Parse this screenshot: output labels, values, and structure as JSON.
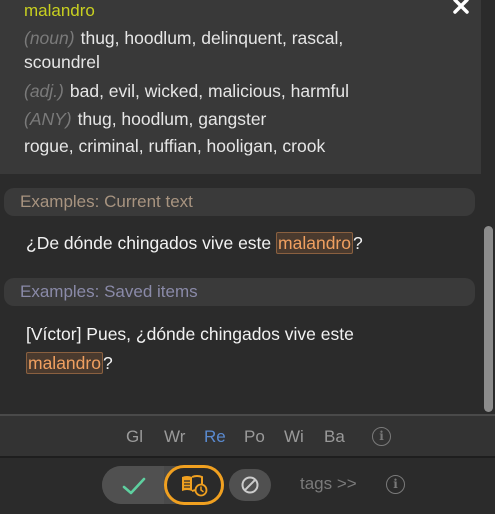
{
  "entry": {
    "headword": "malandro",
    "definitions": [
      {
        "pos": "(noun)",
        "text": "thug, hoodlum, delinquent, rascal,"
      },
      {
        "pos": "",
        "text": "scoundrel"
      },
      {
        "pos": "(adj.)",
        "text": "bad, evil, wicked, malicious, harmful"
      },
      {
        "pos": "(ANY)",
        "text": "thug, hoodlum, gangster"
      },
      {
        "pos": "",
        "text": "rogue, criminal, ruffian, hooligan, crook"
      }
    ]
  },
  "examples": {
    "current_header": "Examples: Current text",
    "current": {
      "before": "¿De dónde chingados vive este ",
      "highlight": "malandro",
      "after": "?"
    },
    "saved_header": "Examples: Saved items",
    "saved": {
      "line1": "[Víctor] Pues, ¿dónde chingados vive este",
      "highlight": "malandro",
      "after": "?"
    }
  },
  "dictionaries": [
    "Gl",
    "Wr",
    "Re",
    "Po",
    "Wi",
    "Ba"
  ],
  "active_dictionary": "Re",
  "actions": {
    "tags_label": "tags >>"
  },
  "icons": {
    "close": "close-icon",
    "info": "info-icon",
    "check": "check-icon",
    "bookmark": "book-clock-icon",
    "ignore": "prohibit-icon"
  },
  "colors": {
    "headword": "#c8d020",
    "highlight": "#f0a060",
    "active_dict": "#5a8ad0",
    "bookmark_ring": "#f0a020"
  }
}
